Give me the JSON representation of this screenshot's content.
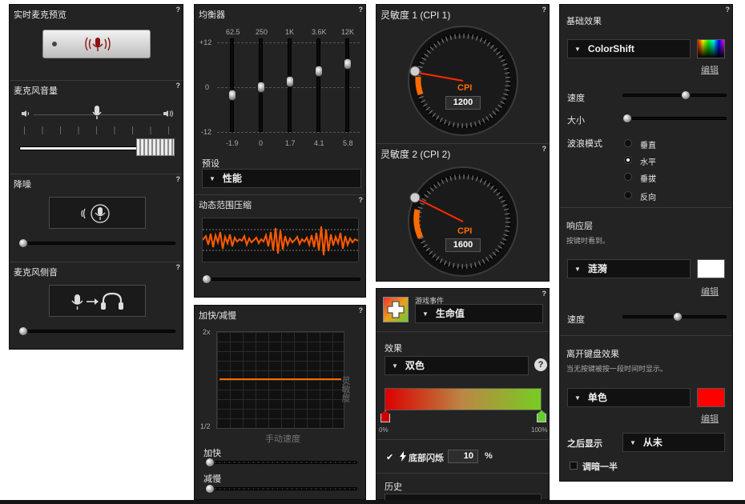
{
  "col1": {
    "mic_preview": {
      "title": "实时麦克预览"
    },
    "mic_volume": {
      "title": "麦克风音量"
    },
    "noise": {
      "title": "降噪"
    },
    "sidetone": {
      "title": "麦克风侧音"
    }
  },
  "col2": {
    "eq": {
      "title": "均衡器",
      "freqs": [
        "62.5",
        "250",
        "1K",
        "3.6K",
        "12K"
      ],
      "scale": [
        "+12",
        "0",
        "-12"
      ],
      "values": [
        "-1.9",
        "0",
        "1.7",
        "4.1",
        "5.8"
      ],
      "preset_label": "预设",
      "preset_value": "性能"
    },
    "drc": {
      "title": "动态范围压缩"
    },
    "accel": {
      "title": "加快/减慢",
      "y_top": "2x",
      "y_bottom": "1/2",
      "x_label": "手动速度",
      "y_label": "灵敏度",
      "accelerate_label": "加快",
      "decelerate_label": "减慢"
    }
  },
  "col3": {
    "cpi1": {
      "title": "灵敏度 1 (CPI 1)",
      "unit": "CPI",
      "value": "1200"
    },
    "cpi2": {
      "title": "灵敏度 2 (CPI 2)",
      "unit": "CPI",
      "value": "1600"
    },
    "event": {
      "event_label": "游戏事件",
      "event_value": "生命值",
      "effect_label": "效果",
      "effect_value": "双色",
      "help_glyph": "?",
      "pct_left": "0%",
      "pct_right": "100%",
      "flash_label": "底部闪烁",
      "flash_value": "10",
      "flash_unit": "%",
      "history_label": "历史"
    }
  },
  "col4": {
    "base": {
      "title": "基础效果",
      "effect_value": "ColorShift",
      "edit": "编辑",
      "speed_label": "速度",
      "size_label": "大小",
      "wave_label": "波浪模式",
      "wave_options": [
        "垂直",
        "水平",
        "垂拔",
        "反向"
      ]
    },
    "response": {
      "title": "响应层",
      "subtitle": "按键时看到。",
      "effect_value": "涟漪",
      "edit": "编辑",
      "speed_label": "速度"
    },
    "idle": {
      "title": "离开键盘效果",
      "subtitle": "当无按键被按一段时间时显示。",
      "effect_value": "单色",
      "edit": "编辑",
      "after_label": "之后显示",
      "after_value": "从未",
      "dim_label": "调暗一半"
    }
  },
  "help_glyph": "?",
  "colors": {
    "accent_orange": "#ff6a00",
    "panel_bg": "#232323",
    "red_swatch": "#ff0000"
  }
}
